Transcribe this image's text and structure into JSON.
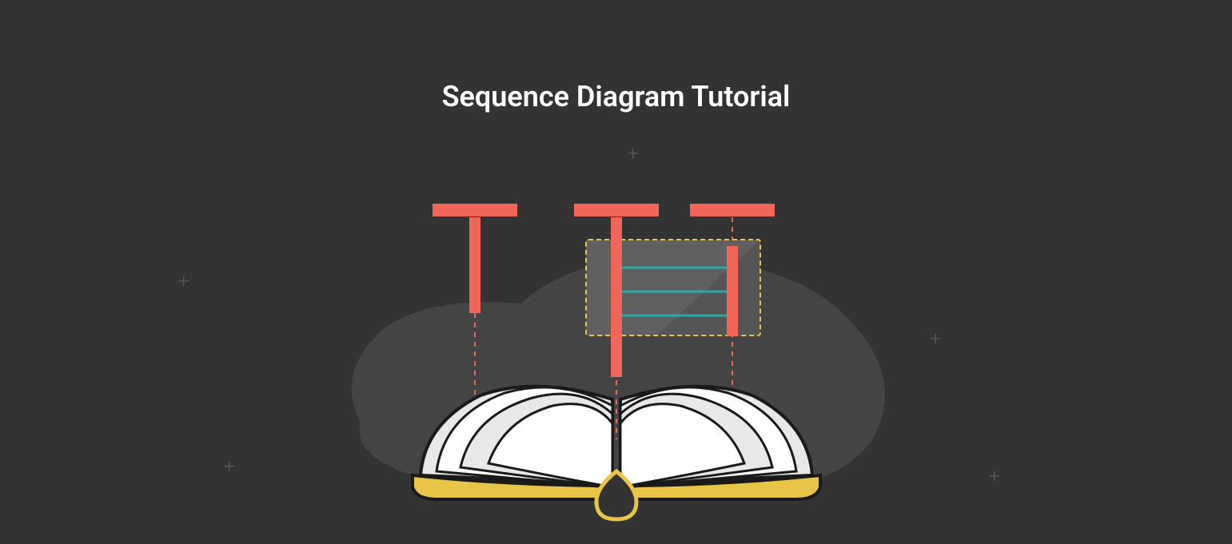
{
  "title": "Sequence Diagram Tutorial",
  "colors": {
    "background": "#333333",
    "coral": "#f26659",
    "yellow": "#e8c547",
    "teal": "#2aa9a5",
    "white": "#ffffff",
    "lightGray": "#e8e8e8",
    "darkGray": "#4a4a4a",
    "plusGray": "#5a5a5a",
    "outline": "#1a1a1a"
  }
}
